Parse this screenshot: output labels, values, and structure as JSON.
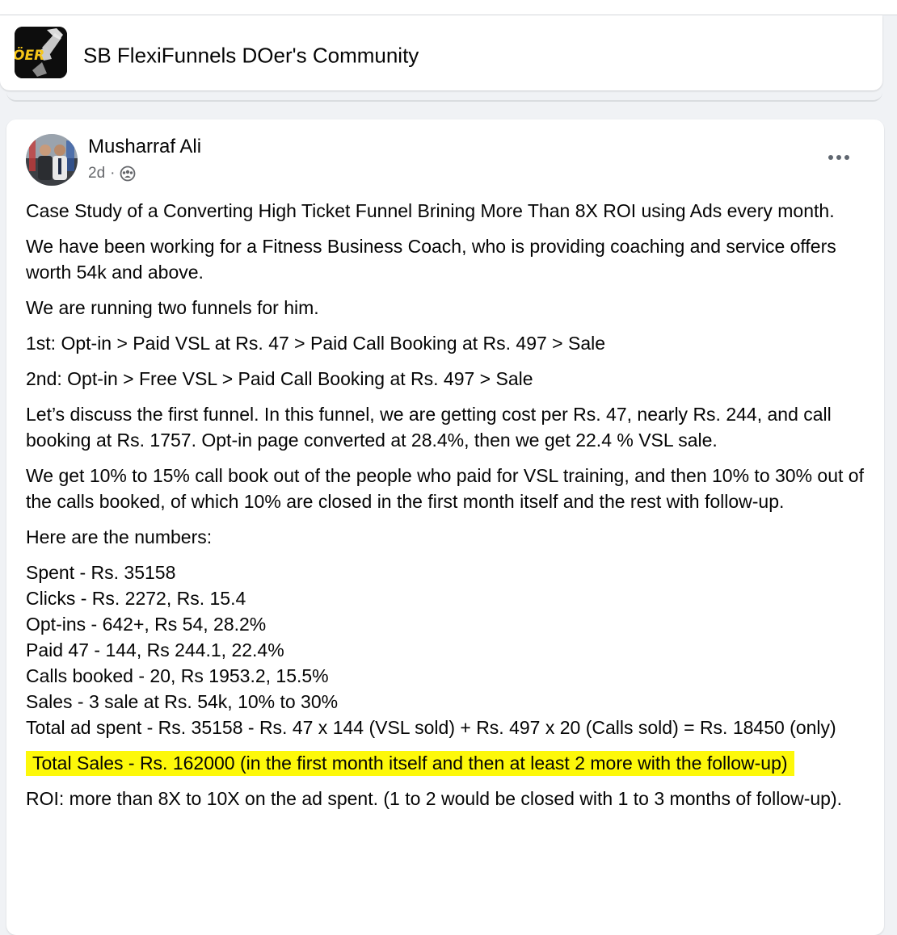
{
  "group": {
    "name": "SB FlexiFunnels DOer's Community",
    "logo_text": "ÖER"
  },
  "post": {
    "author": "Musharraf Ali",
    "time": "2d",
    "separator": "·",
    "privacy_icon": "group-audience-icon",
    "more_icon": "more-options-icon",
    "paragraphs": [
      "Case Study of a Converting High Ticket Funnel Brining More Than 8X ROI using Ads every month.",
      "We have been working for a Fitness Business Coach, who is providing coaching and service offers worth 54k and above.",
      "We are running two funnels for him.",
      "1st: Opt-in > Paid VSL at Rs. 47 > Paid Call Booking at Rs. 497 > Sale",
      "2nd: Opt-in > Free VSL > Paid Call Booking at Rs. 497 > Sale",
      "Let’s discuss the first funnel. In this funnel, we are getting cost per Rs. 47, nearly Rs. 244, and call booking at Rs. 1757. Opt-in page converted at 28.4%, then we get 22.4 % VSL sale.",
      "We get 10% to 15% call book out of the people who paid for VSL training, and then 10% to 30% out of the calls booked, of which 10% are closed in the first month itself and the rest with follow-up.",
      "Here are the numbers:"
    ],
    "numbers": [
      "Spent - Rs. 35158",
      "Clicks - Rs. 2272, Rs. 15.4",
      "Opt-ins - 642+, Rs 54, 28.2%",
      "Paid 47 - 144, Rs 244.1, 22.4%",
      "Calls booked - 20, Rs 1953.2, 15.5%",
      "Sales - 3 sale at Rs. 54k, 10% to 30%",
      "Total ad spent - Rs. 35158 - Rs. 47 x 144 (VSL sold) + Rs. 497 x 20 (Calls sold) = Rs. 18450 (only)"
    ],
    "highlight": "Total Sales - Rs. 162000 (in the first month itself and then at least 2 more with the follow-up)",
    "roi": "ROI: more than 8X to 10X on the ad spent. (1 to 2 would be closed with 1 to 3 months of follow-up)."
  },
  "colors": {
    "highlight": "#fdf80a",
    "meta_text": "#65676b",
    "logo_accent": "#f5c518"
  }
}
